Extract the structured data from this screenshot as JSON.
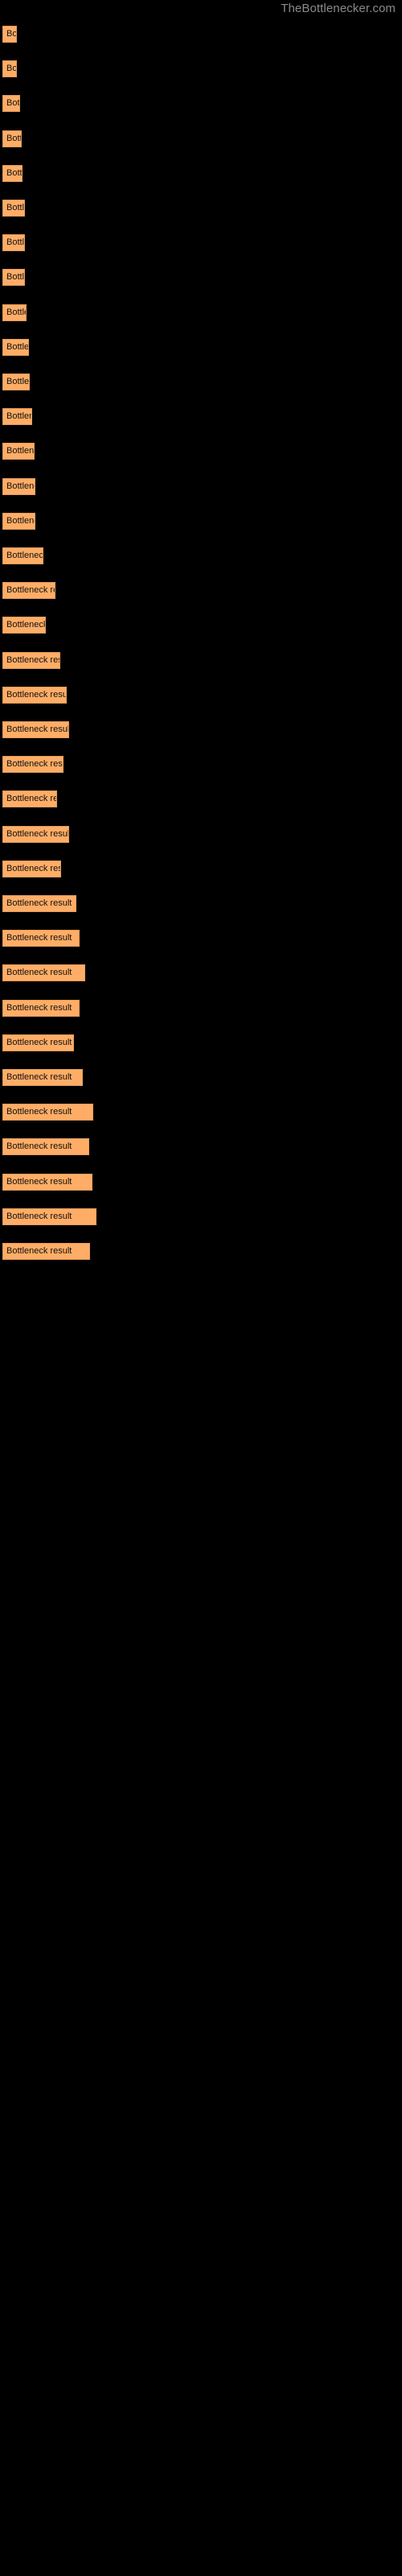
{
  "header": {
    "site_title": "TheBottlenecker.com"
  },
  "chart_data": {
    "type": "bar",
    "title": "",
    "xlabel": "",
    "ylabel": "",
    "orientation": "horizontal",
    "bar_color": "#ffad66",
    "background": "#000000",
    "grid": false,
    "legend": null,
    "xlim": [
      0,
      500
    ],
    "categories": [
      "",
      "",
      "",
      "",
      "",
      "",
      "",
      "",
      "",
      "",
      "",
      "",
      "",
      "",
      "",
      "",
      "",
      "",
      "",
      "",
      "",
      "",
      "",
      "",
      "",
      "",
      "",
      "",
      "",
      "",
      "",
      "",
      "",
      "",
      "",
      ""
    ],
    "labels": [
      "Bottleneck result",
      "Bottleneck result",
      "Bottleneck result",
      "Bottleneck result",
      "Bottleneck result",
      "Bottleneck result",
      "Bottleneck result",
      "Bottleneck result",
      "Bottleneck result",
      "Bottleneck result",
      "Bottleneck result",
      "Bottleneck result",
      "Bottleneck result",
      "Bottleneck result",
      "Bottleneck result",
      "Bottleneck result",
      "Bottleneck result",
      "Bottleneck result",
      "Bottleneck result",
      "Bottleneck result",
      "Bottleneck result",
      "Bottleneck result",
      "Bottleneck result",
      "Bottleneck result",
      "Bottleneck result",
      "Bottleneck result",
      "Bottleneck result",
      "Bottleneck result",
      "Bottleneck result",
      "Bottleneck result",
      "Bottleneck result",
      "Bottleneck result",
      "Bottleneck result",
      "Bottleneck result",
      "Bottleneck result",
      "Bottleneck result"
    ],
    "values": [
      18,
      18,
      22,
      24,
      25,
      28,
      28,
      28,
      30,
      33,
      34,
      37,
      40,
      41,
      41,
      51,
      66,
      54,
      72,
      80,
      83,
      76,
      68,
      83,
      73,
      92,
      96,
      103,
      96,
      89,
      100,
      113,
      108,
      112,
      117,
      109
    ],
    "y_positions": [
      6,
      49,
      92,
      135,
      178,
      221,
      264,
      307,
      350,
      393,
      436,
      479,
      522,
      565,
      608,
      651,
      694,
      737,
      780,
      823,
      866,
      909,
      952,
      995,
      1038,
      1081,
      1124,
      1167,
      1210,
      1253,
      1296,
      1339,
      1382,
      1425,
      1468,
      1511
    ]
  }
}
